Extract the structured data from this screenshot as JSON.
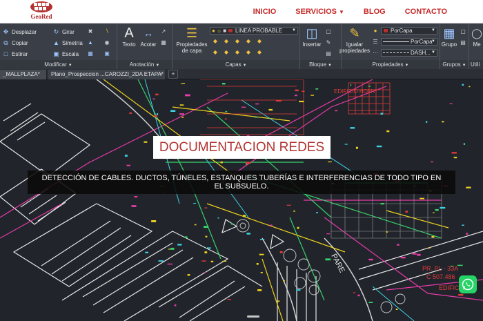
{
  "site": {
    "logo_text": "GeoRed",
    "brand_color": "#b3322f",
    "nav": [
      {
        "label": "INICIO",
        "has_dropdown": false
      },
      {
        "label": "SERVICIOS",
        "has_dropdown": true
      },
      {
        "label": "BLOG",
        "has_dropdown": false
      },
      {
        "label": "CONTACTO",
        "has_dropdown": false
      }
    ]
  },
  "ribbon": {
    "modify": {
      "label": "Modificar",
      "items": [
        "Desplazar",
        "Girar",
        "Copiar",
        "Simetría",
        "Estirar",
        "Escala"
      ]
    },
    "annotation": {
      "label": "Anotación",
      "text_btn": "Texto",
      "dim_btn": "Acotar"
    },
    "layers": {
      "label": "Capas",
      "props_btn": "Propiedades de capa",
      "layer_name": "LINEA PROBABLE",
      "layer_color": "#b3322f"
    },
    "block": {
      "label": "Bloque",
      "insert_btn": "Insertar"
    },
    "properties": {
      "label": "Propiedades",
      "match_btn": "Igualar propiedades",
      "color_value": "PorCapa",
      "lineweight_value": "PorCapa",
      "linetype_value": "DASH..."
    },
    "groups": {
      "label": "Grupos",
      "group_btn": "Grupo"
    },
    "utilities": {
      "label": "Utili",
      "measure_btn": "Me"
    }
  },
  "tabs": [
    {
      "label": "_MALLPLAZA*"
    },
    {
      "label": "Plano_Prospeccion ...CAROZZI_2DA ETAPA*"
    }
  ],
  "drawing": {
    "labels": [
      "EDIFICIO HOMY",
      "PARE",
      "PR. PL - 33A",
      "C 507.486",
      "EDIFICI"
    ]
  },
  "hero": {
    "title": "DOCUMENTACION REDES",
    "description": "DETECCIÓN DE CABLES. DUCTOS, TÚNELES, ESTANQUES TUBERÍAS E INTERFERENCIAS DE TODO TIPO EN EL SUBSUELO."
  },
  "icons": {
    "whatsapp": "whatsapp-icon"
  }
}
